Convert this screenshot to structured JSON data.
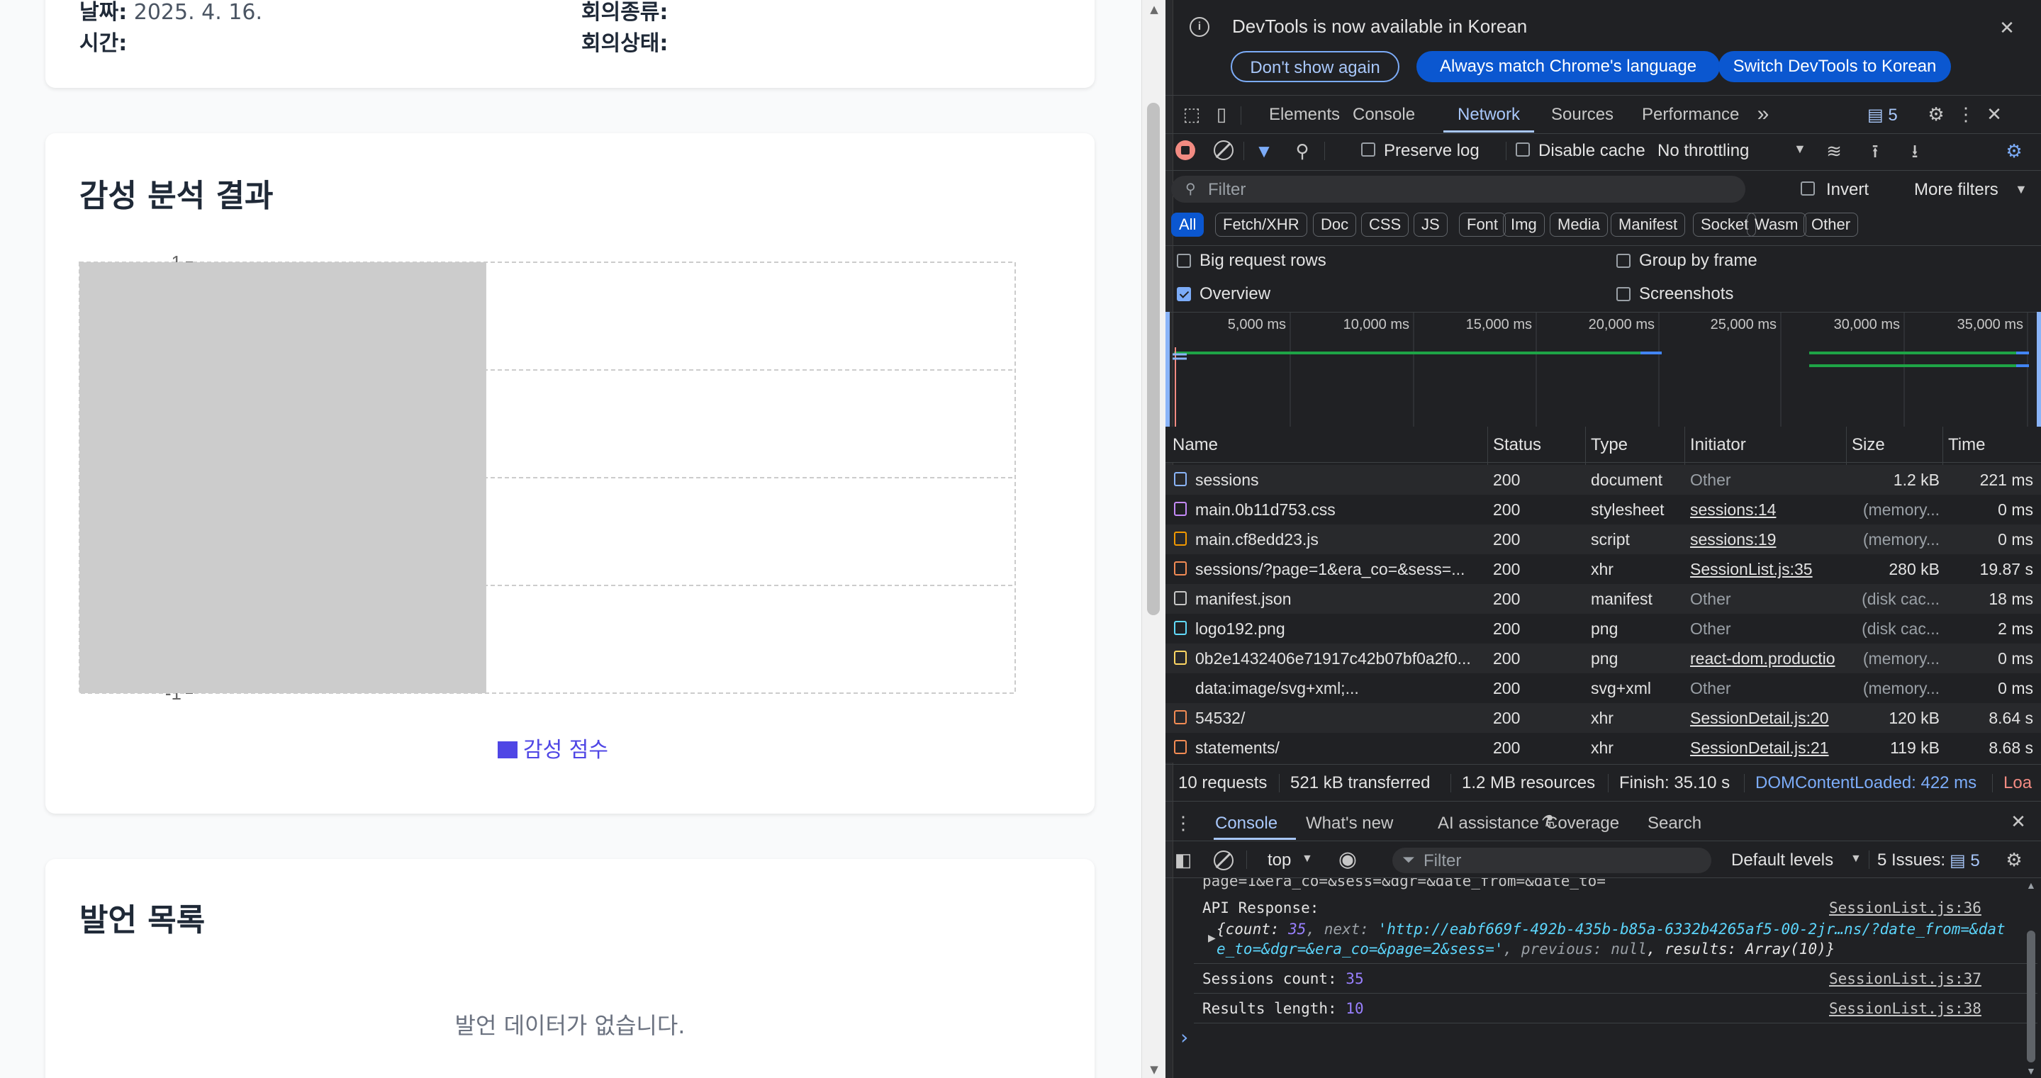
{
  "meeting": {
    "date_label": "날짜:",
    "date_value": "2025. 4. 16.",
    "type_label": "회의종류:",
    "time_label": "시간:",
    "status_label": "회의상태:"
  },
  "sentiment": {
    "title": "감성 분석 결과",
    "legend": "감성 점수",
    "legend_color": "#4f46e5",
    "bar_color": "#cccccc"
  },
  "chart_data": {
    "type": "bar",
    "categories": [
      ""
    ],
    "series": [
      {
        "name": "감성 점수",
        "values": [
          0
        ]
      }
    ],
    "ylim": [
      -1,
      1
    ],
    "yticks": [
      "1",
      "-1"
    ],
    "grid": true,
    "legend_position": "bottom"
  },
  "statements": {
    "title": "발언 목록",
    "empty_text": "발언 데이터가 없습니다."
  },
  "devtools": {
    "infobar": {
      "message": "DevTools is now available in Korean",
      "btn_dont_show": "Don't show again",
      "btn_match_lang": "Always match Chrome's language",
      "btn_switch": "Switch DevTools to Korean"
    },
    "main_tabs": [
      "Elements",
      "Console",
      "Network",
      "Sources",
      "Performance"
    ],
    "issues_badge": "5",
    "toolbar": {
      "preserve_log": "Preserve log",
      "disable_cache": "Disable cache",
      "throttling": "No throttling"
    },
    "filter": {
      "placeholder": "Filter",
      "invert": "Invert",
      "more_filters": "More filters"
    },
    "type_chips": [
      "All",
      "Fetch/XHR",
      "Doc",
      "CSS",
      "JS",
      "Font",
      "Img",
      "Media",
      "Manifest",
      "Socket",
      "Wasm",
      "Other"
    ],
    "options": {
      "big_rows": "Big request rows",
      "group_by_frame": "Group by frame",
      "overview": "Overview",
      "screenshots": "Screenshots"
    },
    "timeline_ticks": [
      "5,000 ms",
      "10,000 ms",
      "15,000 ms",
      "20,000 ms",
      "25,000 ms",
      "30,000 ms",
      "35,000 ms"
    ],
    "columns": [
      "Name",
      "Status",
      "Type",
      "Initiator",
      "Size",
      "Time"
    ],
    "requests": [
      {
        "name": "sessions",
        "icon": "document-icon",
        "icon_color": "#8ab4f8",
        "status": "200",
        "type": "document",
        "initiator": "Other",
        "size": "1.2 kB",
        "time": "221 ms"
      },
      {
        "name": "main.0b11d753.css",
        "icon": "stylesheet-icon",
        "icon_color": "#c58af9",
        "status": "200",
        "type": "stylesheet",
        "initiator": "sessions:14",
        "size": "(memory...",
        "time": "0 ms"
      },
      {
        "name": "main.cf8edd23.js",
        "icon": "script-icon",
        "icon_color": "#f29900",
        "status": "200",
        "type": "script",
        "initiator": "sessions:19",
        "size": "(memory...",
        "time": "0 ms"
      },
      {
        "name": "sessions/?page=1&era_co=&sess=...",
        "icon": "xhr-icon",
        "icon_color": "#f28b54",
        "status": "200",
        "type": "xhr",
        "initiator": "SessionList.js:35",
        "size": "280 kB",
        "time": "19.87 s"
      },
      {
        "name": "manifest.json",
        "icon": "manifest-icon",
        "icon_color": "#c7c7c7",
        "status": "200",
        "type": "manifest",
        "initiator": "Other",
        "size": "(disk cac...",
        "time": "18 ms"
      },
      {
        "name": "logo192.png",
        "icon": "react-logo-icon",
        "icon_color": "#61dafb",
        "status": "200",
        "type": "png",
        "initiator": "Other",
        "size": "(disk cac...",
        "time": "2 ms"
      },
      {
        "name": "0b2e1432406e71917c42b07bf0a2f0...",
        "icon": "image-icon",
        "icon_color": "#fdd663",
        "status": "200",
        "type": "png",
        "initiator": "react-dom.productio",
        "size": "(memory...",
        "time": "0 ms"
      },
      {
        "name": "data:image/svg+xml;...",
        "icon": "svg-icon",
        "icon_color": "#202124",
        "status": "200",
        "type": "svg+xml",
        "initiator": "Other",
        "size": "(memory...",
        "time": "0 ms"
      },
      {
        "name": "54532/",
        "icon": "xhr-icon",
        "icon_color": "#f28b54",
        "status": "200",
        "type": "xhr",
        "initiator": "SessionDetail.js:20",
        "size": "120 kB",
        "time": "8.64 s"
      },
      {
        "name": "statements/",
        "icon": "xhr-icon",
        "icon_color": "#f28b54",
        "status": "200",
        "type": "xhr",
        "initiator": "SessionDetail.js:21",
        "size": "119 kB",
        "time": "8.68 s"
      }
    ],
    "summary": {
      "requests": "10 requests",
      "transferred": "521 kB transferred",
      "resources": "1.2 MB resources",
      "finish": "Finish: 35.10 s",
      "dom_loaded": "DOMContentLoaded: 422 ms",
      "load": "Loa"
    },
    "drawer_tabs": [
      "Console",
      "What's new",
      "AI assistance",
      "Coverage",
      "Search"
    ],
    "console_toolbar": {
      "context": "top",
      "filter_placeholder": "Filter",
      "levels": "Default levels",
      "issues": "5 Issues:",
      "issues_count": "5"
    },
    "console": {
      "partial_line": "page=1&era_co=&sess=&dgr=&date_from=&date_to=",
      "api_label": "API Response:",
      "api_src": "SessionList.js:36",
      "obj_prefix": "{count: ",
      "obj_count": "35",
      "obj_next_key": ", next: ",
      "obj_next_val": "'http://eabf669f-492b-435b-b85a-6332b4265af5-00-2jr…ns/?date_from=&dat",
      "obj_line2_val": "e_to=&dgr=&era_co=&page=2&sess='",
      "obj_prev_key": ", previous: ",
      "obj_prev_val": "null",
      "obj_results": ", results: Array(10)}",
      "count_label": "Sessions count: ",
      "count_value": "35",
      "count_src": "SessionList.js:37",
      "len_label": "Results length: ",
      "len_value": "10",
      "len_src": "SessionList.js:38",
      "prompt": "›"
    }
  }
}
